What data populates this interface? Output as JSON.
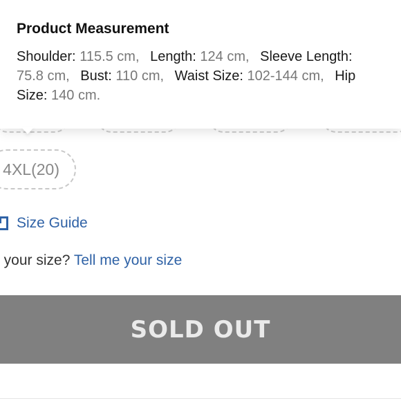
{
  "tooltip": {
    "title": "Product Measurement",
    "measurements": [
      {
        "label": "Shoulder:",
        "value": "115.5 cm,"
      },
      {
        "label": "Length:",
        "value": "124 cm,"
      },
      {
        "label": "Sleeve Length:",
        "value": "75.8 cm,"
      },
      {
        "label": "Bust:",
        "value": "110 cm,"
      },
      {
        "label": "Waist Size:",
        "value": "102-144 cm,"
      },
      {
        "label": "Hip Size:",
        "value": "140 cm."
      }
    ]
  },
  "sizes": {
    "visible_chip": "4XL(20)"
  },
  "size_guide": {
    "label": "Size Guide",
    "icon": "ruler-icon"
  },
  "help": {
    "prefix": "t your size?",
    "link": "Tell me your size"
  },
  "cta": {
    "label": "SOLD OUT"
  },
  "colors": {
    "link": "#2f62a6",
    "button_bg": "#808080",
    "value_gray": "#777777"
  }
}
